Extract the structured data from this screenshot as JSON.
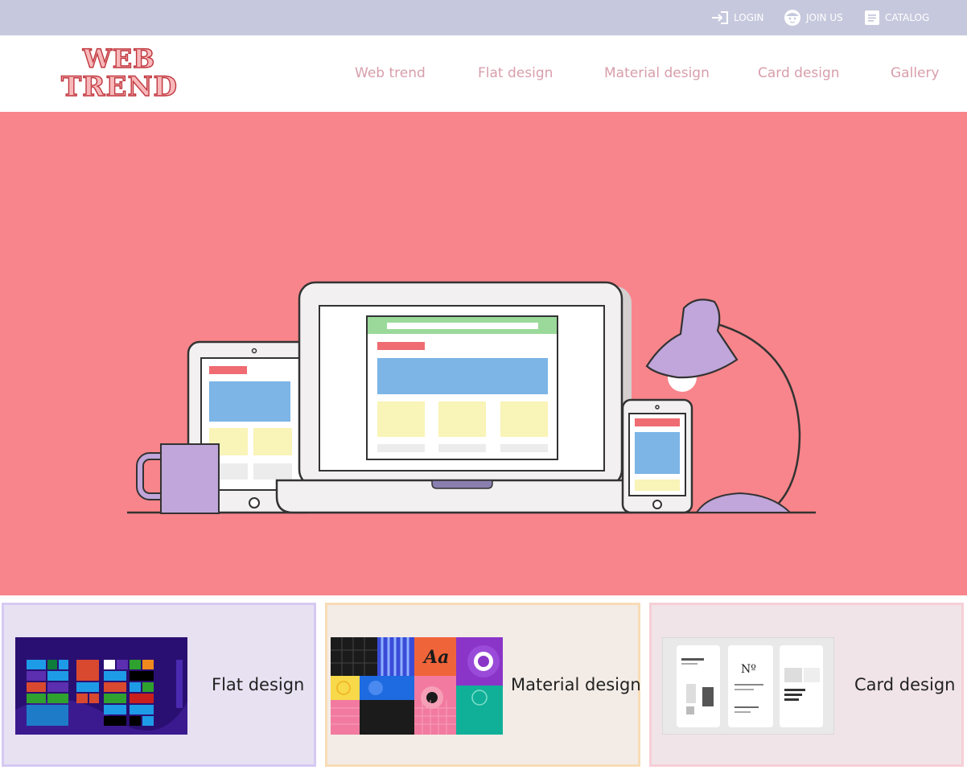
{
  "topbar": {
    "login_label": "LOGIN",
    "join_label": "JOIN US",
    "catalog_label": "CATALOG"
  },
  "logo": {
    "line1": "WEB",
    "line2": "TREND"
  },
  "nav": {
    "items": [
      {
        "label": "Web trend"
      },
      {
        "label": "Flat design"
      },
      {
        "label": "Material design"
      },
      {
        "label": "Card design"
      },
      {
        "label": "Gallery"
      }
    ]
  },
  "hero": {
    "illustration_icons": [
      "tablet-icon",
      "laptop-icon",
      "phone-icon",
      "mug-icon",
      "desk-lamp-icon"
    ]
  },
  "cards": [
    {
      "title": "Flat design",
      "thumb": "windows-start-screen-thumbnail"
    },
    {
      "title": "Material design",
      "thumb": "material-design-tiles-thumbnail"
    },
    {
      "title": "Card design",
      "thumb": "card-layout-mockup-thumbnail"
    }
  ],
  "colors": {
    "topbar_bg": "#c6c8dd",
    "nav_text": "#d89eab",
    "hero_bg": "#f8858b",
    "card1_bg": "#e8e1f2",
    "card2_bg": "#f3ece6",
    "card3_bg": "#f0e4e8"
  }
}
